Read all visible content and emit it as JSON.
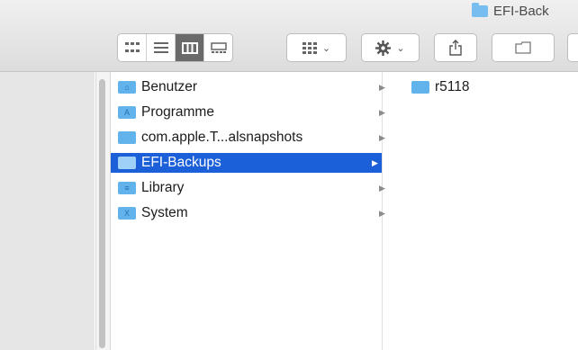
{
  "window": {
    "title": "EFI-Back"
  },
  "toolbar": {
    "view_modes": [
      {
        "name": "icon-view",
        "icon": "grid-icon",
        "active": false
      },
      {
        "name": "list-view",
        "icon": "list-icon",
        "active": false
      },
      {
        "name": "column-view",
        "icon": "columns-icon",
        "active": true
      },
      {
        "name": "gallery-view",
        "icon": "gallery-icon",
        "active": false
      }
    ],
    "group_icon": "group-grid-icon",
    "action_icon": "gear-icon",
    "share_icon": "share-icon",
    "tag_icon": "tag-icon",
    "chevron": "⌄"
  },
  "column1": {
    "items": [
      {
        "label": "Benutzer",
        "icon_glyph": "⌂",
        "selected": false
      },
      {
        "label": "Programme",
        "icon_glyph": "A",
        "selected": false
      },
      {
        "label": "com.apple.T...alsnapshots",
        "icon_glyph": "",
        "selected": false
      },
      {
        "label": "EFI-Backups",
        "icon_glyph": "",
        "selected": true
      },
      {
        "label": "Library",
        "icon_glyph": "≡",
        "selected": false
      },
      {
        "label": "System",
        "icon_glyph": "X",
        "selected": false
      }
    ],
    "arrow": "▶"
  },
  "column2": {
    "items": [
      {
        "label": "r5118"
      }
    ]
  },
  "colors": {
    "selection": "#1b5fd9",
    "folder": "#62b2ec"
  }
}
